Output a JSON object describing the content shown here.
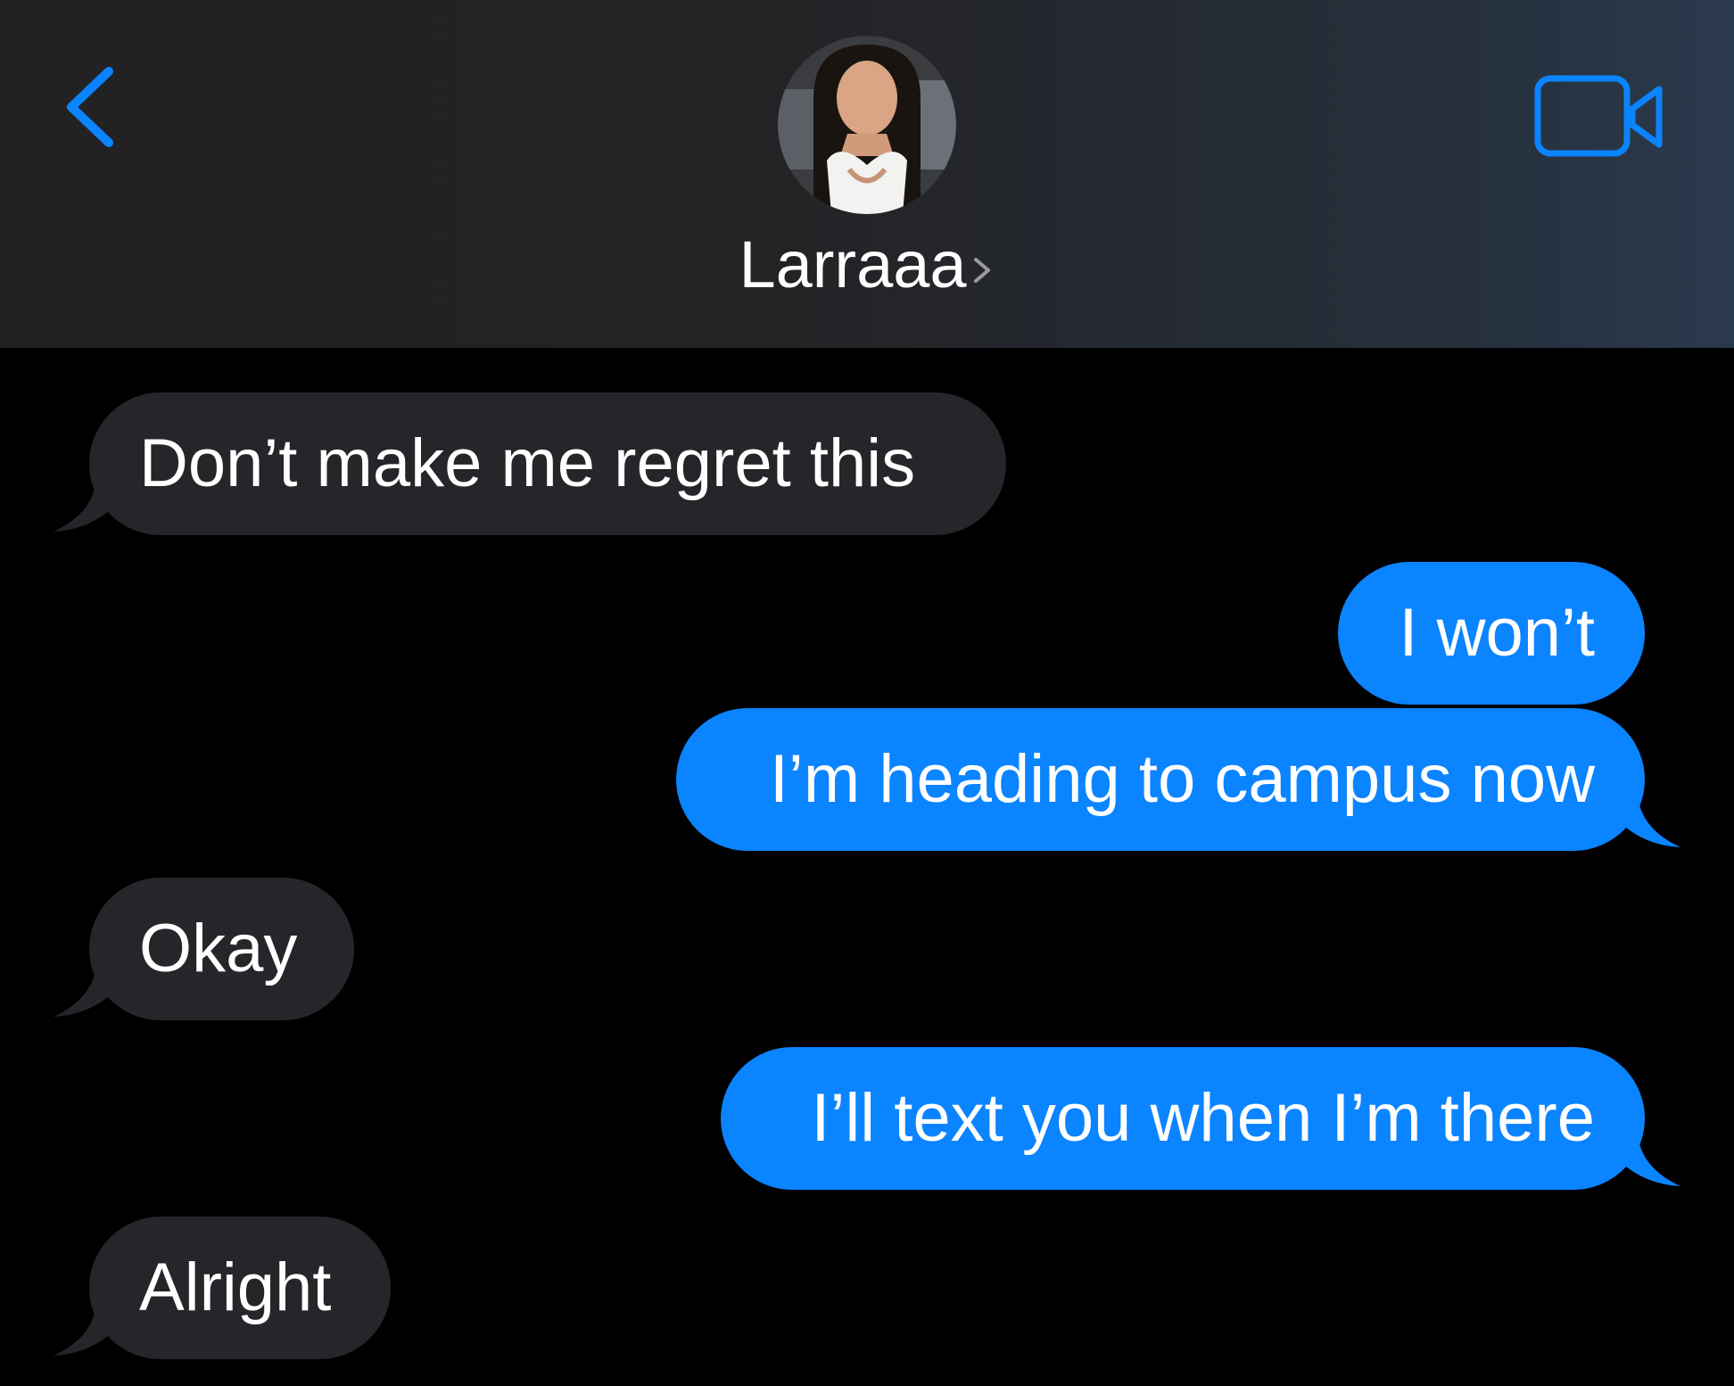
{
  "header": {
    "contact_name": "Larraaa",
    "back_icon": "chevron-left-icon",
    "video_icon": "video-camera-icon",
    "accent_color": "#0b84ff",
    "avatar_description": "contact-photo"
  },
  "messages": [
    {
      "id": "m1",
      "direction": "received",
      "text": "Don’t make me regret this"
    },
    {
      "id": "m2",
      "direction": "sent",
      "text": "I won’t"
    },
    {
      "id": "m3",
      "direction": "sent",
      "text": "I’m heading to campus now"
    },
    {
      "id": "m4",
      "direction": "received",
      "text": "Okay"
    },
    {
      "id": "m5",
      "direction": "sent",
      "text": "I’ll text you when I’m there"
    },
    {
      "id": "m6",
      "direction": "received",
      "text": "Alright"
    }
  ],
  "colors": {
    "received_bubble": "#26252a",
    "sent_bubble": "#0b84ff",
    "background": "#000000"
  }
}
